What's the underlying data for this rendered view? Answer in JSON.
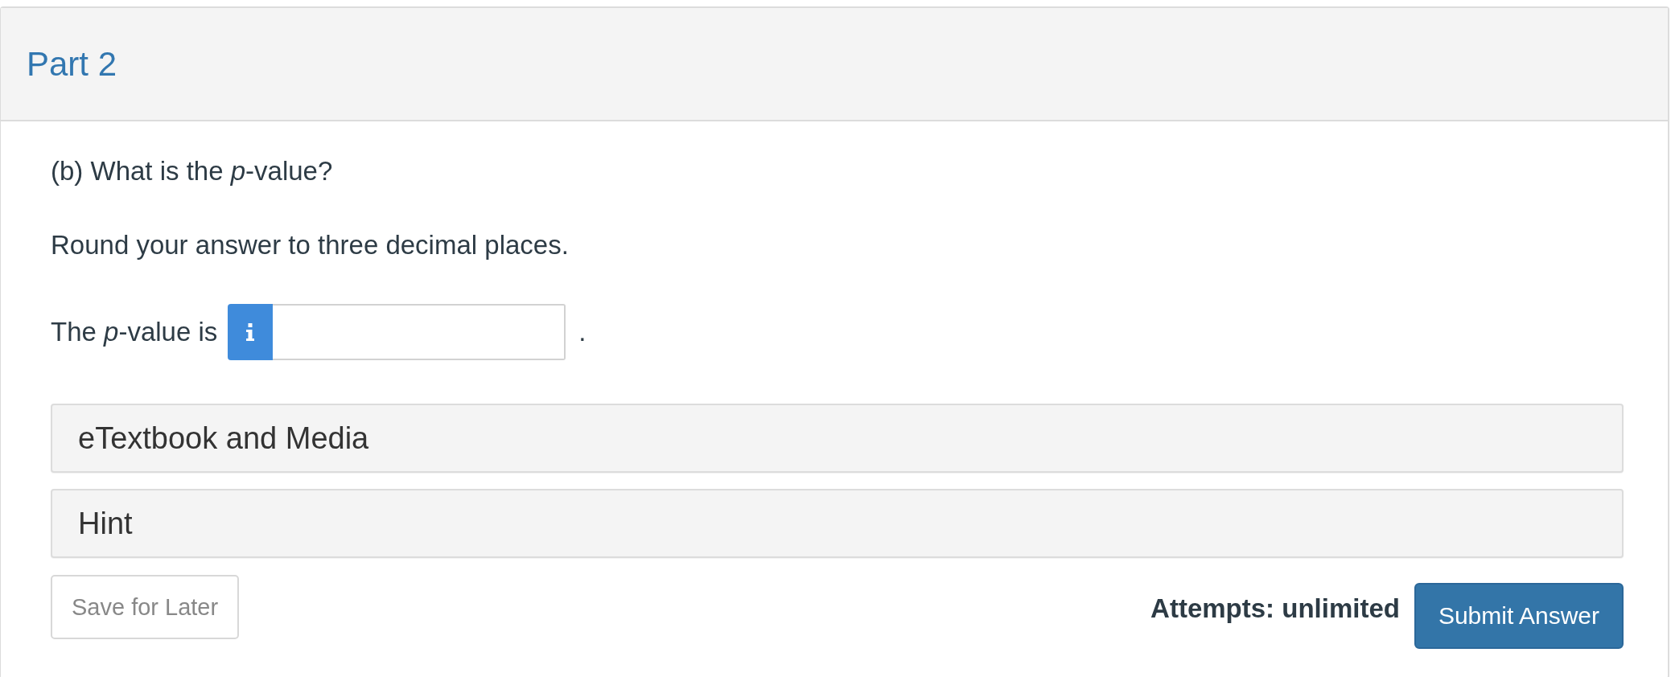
{
  "part": {
    "title": "Part 2"
  },
  "question": {
    "prompt": "(b) What is the *p*-value?",
    "instruction": "Round your answer to three decimal places.",
    "answer": {
      "label": "The *p*-value is",
      "suffix": "."
    }
  },
  "panels": [
    {
      "label": "eTextbook and Media"
    },
    {
      "label": "Hint"
    }
  ],
  "footer": {
    "save_button": "Save for Later",
    "attempts": "Attempts: unlimited",
    "submit_button": "Submit Answer"
  }
}
